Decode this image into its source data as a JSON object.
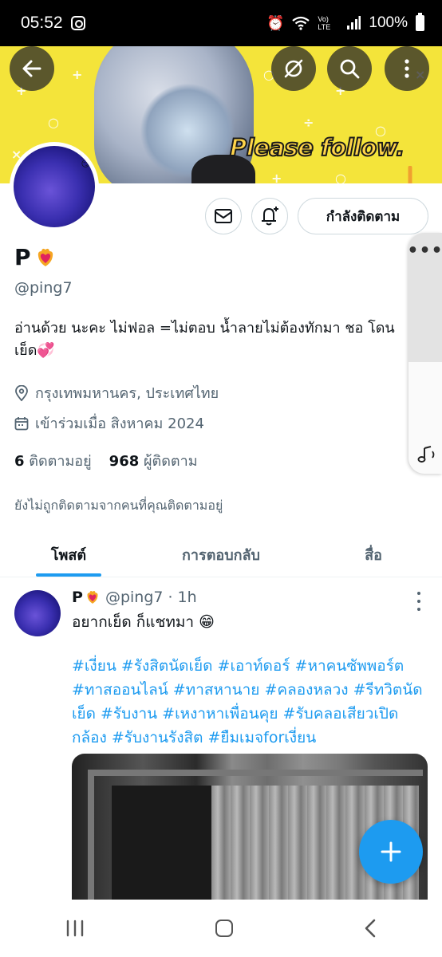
{
  "status_bar": {
    "time": "05:52",
    "battery": "100%",
    "network": "Vo) LTE"
  },
  "banner": {
    "overlay_text": "Please follow.",
    "colors": {
      "background": "#f4e43a",
      "text": "#ffd44a"
    }
  },
  "header_buttons": {
    "back_icon": "arrow-left-icon",
    "mute_icon": "eye-slash-icon",
    "search_icon": "search-icon",
    "more_icon": "more-vertical-icon"
  },
  "profile": {
    "name": "P",
    "handle": "@ping7",
    "bio": "อ่านด้วย นะคะ ไม่ฟอล =ไม่ตอบ   น้ำลายไม่ต้องทักมา ชอ โดนเย็ด💞",
    "location": "กรุงเทพมหานคร, ประเทศไทย",
    "joined": "เข้าร่วมเมื่อ สิงหาคม 2024",
    "following_count": "6",
    "following_label": "ติดตามอยู่",
    "followers_count": "968",
    "followers_label": "ผู้ติดตาม",
    "not_followed_text": "ยังไม่ถูกติดตามจากคนที่คุณติดตามอยู่",
    "following_button": "กำลังติดตาม"
  },
  "tabs": [
    {
      "label": "โพสต์",
      "active": true
    },
    {
      "label": "การตอบกลับ",
      "active": false
    },
    {
      "label": "สื่อ",
      "active": false
    }
  ],
  "post": {
    "author": "P",
    "handle": "@ping7",
    "time": "· 1h",
    "text": "อยากเย็ด ก็แชทมา 😁",
    "hashtags": "#เงี่ยน #รังสิตนัดเย็ด #เอาท์ดอร์ #หาคนซัพพอร์ต #ทาสออนไลน์ #ทาสหานาย #คลองหลวง #รีทวิตนัดเย็ด #รับงาน #เหงาหาเพื่อนคุย #รับคลอเสียวเปิดกล้อง #รับงานรังสิต #ยืมเมจforเงี่ยน"
  },
  "colors": {
    "accent": "#1d9bf0",
    "secondary_text": "#536471",
    "primary_text": "#0f1419"
  }
}
